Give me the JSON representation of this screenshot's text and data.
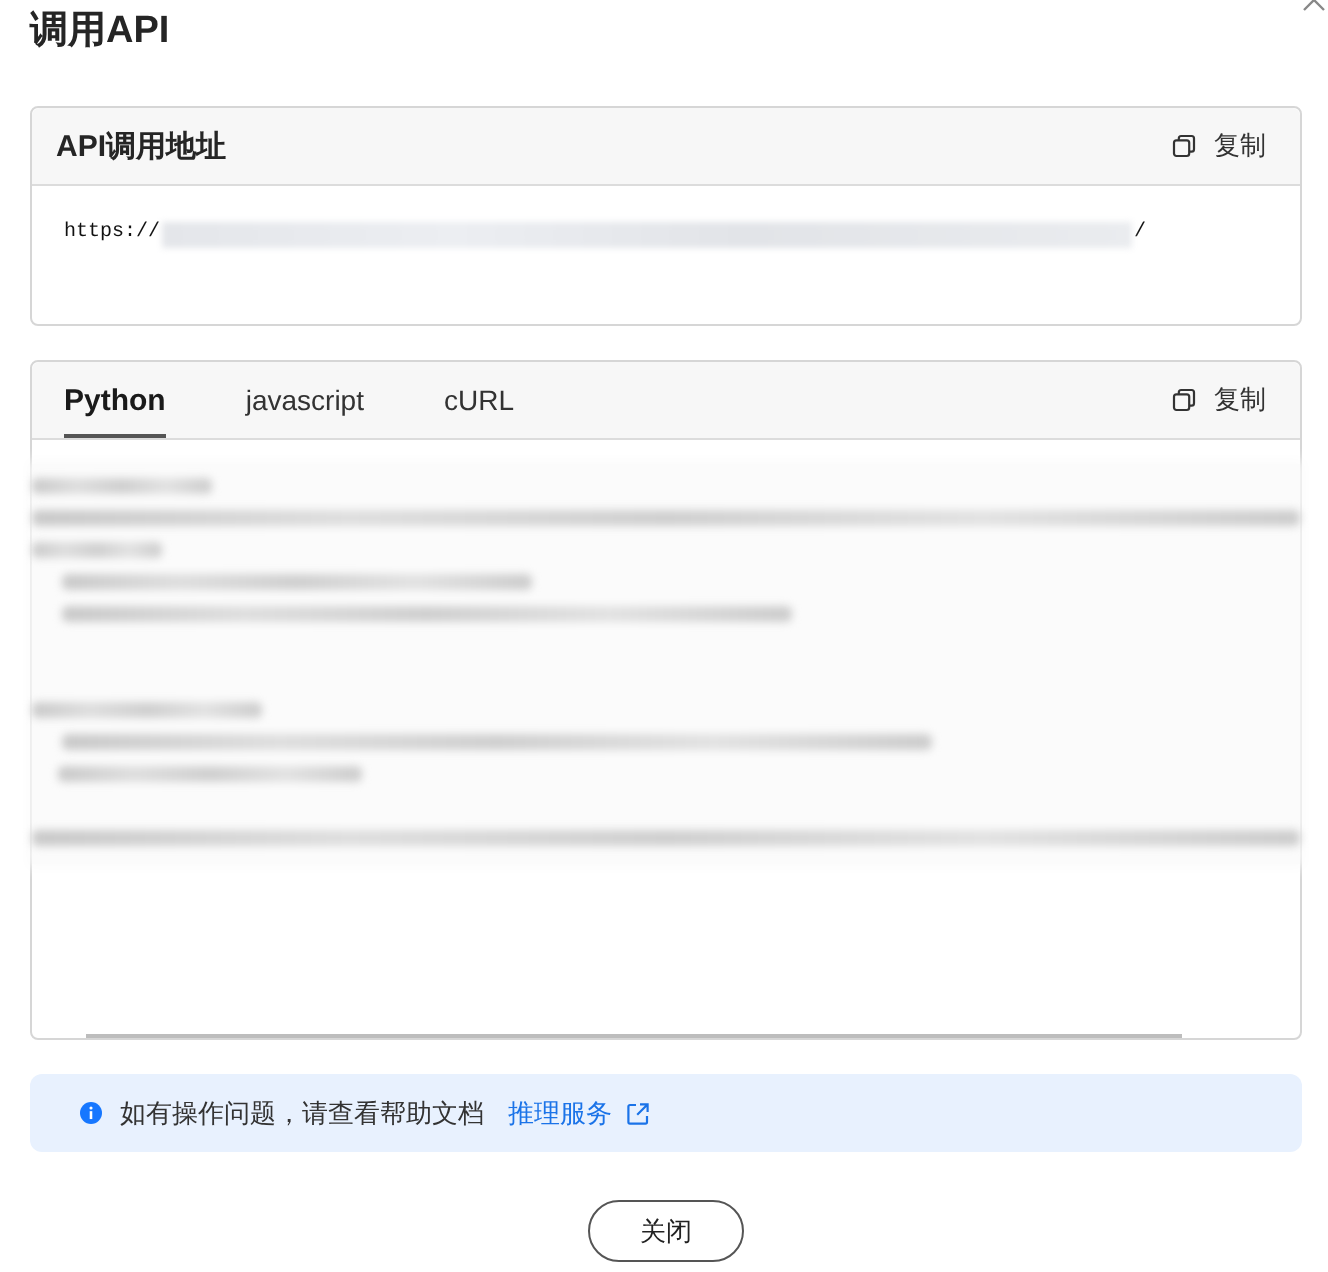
{
  "dialog": {
    "title": "调用API"
  },
  "api_address": {
    "title": "API调用地址",
    "copy_label": "复制",
    "url_prefix": "https://",
    "url_suffix": "/"
  },
  "code_panel": {
    "tabs": [
      {
        "label": "Python",
        "selected": true
      },
      {
        "label": "javascript",
        "selected": false
      },
      {
        "label": "cURL",
        "selected": false
      }
    ],
    "copy_label": "复制"
  },
  "notice": {
    "text": "如有操作问题，请查看帮助文档",
    "link": "推理服务"
  },
  "buttons": [
    {
      "label": "关闭"
    }
  ]
}
